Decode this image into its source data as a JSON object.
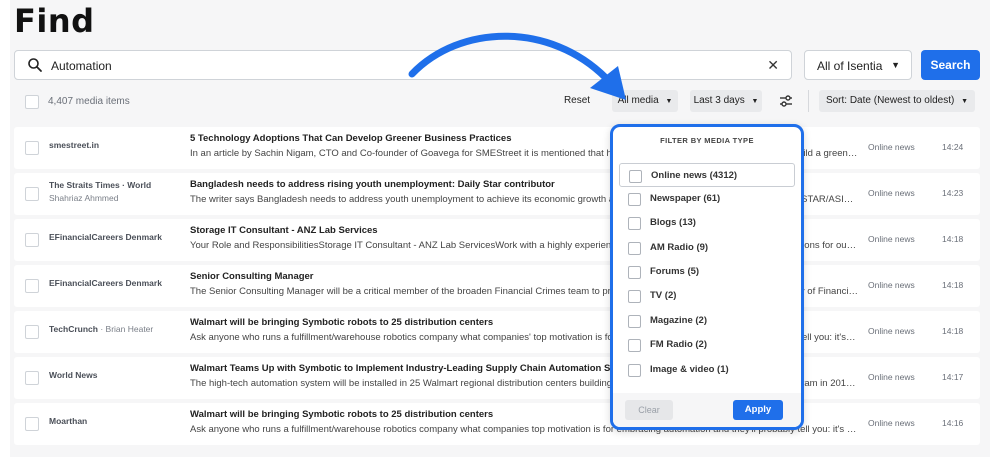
{
  "page": {
    "title": "Find"
  },
  "search": {
    "value": "Automation",
    "scope": "All of Isentia",
    "button_label": "Search"
  },
  "toolbar": {
    "count": "4,407 media items",
    "reset_label": "Reset",
    "media_label": "All media",
    "date_label": "Last 3 days",
    "sort_label": "Sort: Date (Newest to oldest)"
  },
  "rows": [
    {
      "source": "smestreet.in",
      "author": "",
      "byline": "",
      "headline": "5 Technology Adoptions That Can Develop Greener Business Practices",
      "snippet": "In an article by Sachin Nigam, CTO and Co-founder of Goavega for SMEStreet it is mentioned that how businesses can leverage technology to build a greener future by the adop…",
      "media_type": "Online news",
      "time": "14:24"
    },
    {
      "source": "The Straits Times · World",
      "author": "",
      "byline": "Shahriaz Ahmmed",
      "headline": "Bangladesh needs to address rising youth unemployment: Daily Star contributor",
      "snippet": "The writer says Bangladesh needs to address youth unemployment to achieve its economic growth and development goals. DHAKA (THE DAILY STAR/ASIA NEWS NETWORK) – DHAKA (THE D…",
      "media_type": "Online news",
      "time": "14:23"
    },
    {
      "source": "EFinancialCareers Denmark",
      "author": "",
      "byline": "",
      "headline": "Storage IT Consultant - ANZ Lab Services",
      "snippet": "Your Role and ResponsibilitiesStorage IT Consultant - ANZ Lab ServicesWork with a highly experienced team of IT professionals and deliver solutions for our clients' critical wo…",
      "media_type": "Online news",
      "time": "14:18"
    },
    {
      "source": "EFinancialCareers Denmark",
      "author": "",
      "byline": "",
      "headline": "Senior Consulting Manager",
      "snippet": "The Senior Consulting Manager will be a critical member of the broaden Financial Crimes team to provide thought leadership and oversee delivery of Financial Crimes Compliance and Automation Orga…",
      "media_type": "Online news",
      "time": "14:18"
    },
    {
      "source": "TechCrunch",
      "author": " · Brian Heater",
      "byline": "",
      "headline": "Walmart will be bringing Symbotic robots to 25 distribution centers",
      "snippet": "Ask anyone who runs a fulfillment/warehouse robotics company what companies' top motivation is for embracing automation and they'll probably tell you: it's the chronic labor s…",
      "media_type": "Online news",
      "time": "14:18"
    },
    {
      "source": "World News",
      "author": "",
      "byline": "",
      "headline": "Walmart Teams Up with Symbotic to Implement Industry-Leading Supply Chain Automation System",
      "snippet": "The high-tech automation system will be installed in 25 Walmart regional distribution centers building on a relationship that began with a pilot program in 2017. BENTON…",
      "media_type": "Online news",
      "time": "14:17"
    },
    {
      "source": "Moarthan",
      "author": "",
      "byline": "",
      "headline": "Walmart will be bringing Symbotic robots to 25 distribution centers",
      "snippet": "Ask anyone who runs a fulfillment/warehouse robotics company what companies top motivation is for embracing automation and they'll probably tell you: it's the chronic labor s…",
      "media_type": "Online news",
      "time": "14:16"
    }
  ],
  "filter": {
    "title": "FILTER BY MEDIA TYPE",
    "options": [
      {
        "label": "Online news (4312)"
      },
      {
        "label": "Newspaper (61)"
      },
      {
        "label": "Blogs (13)"
      },
      {
        "label": "AM Radio (9)"
      },
      {
        "label": "Forums (5)"
      },
      {
        "label": "TV (2)"
      },
      {
        "label": "Magazine (2)"
      },
      {
        "label": "FM Radio (2)"
      },
      {
        "label": "Image & video (1)"
      }
    ],
    "clear_label": "Clear",
    "apply_label": "Apply"
  },
  "colors": {
    "accent": "#1f6fea",
    "background": "#f6f6f7"
  },
  "icons": [
    "search-icon",
    "close-icon",
    "chevron-down-icon",
    "sliders-icon",
    "curved-arrow-icon"
  ]
}
